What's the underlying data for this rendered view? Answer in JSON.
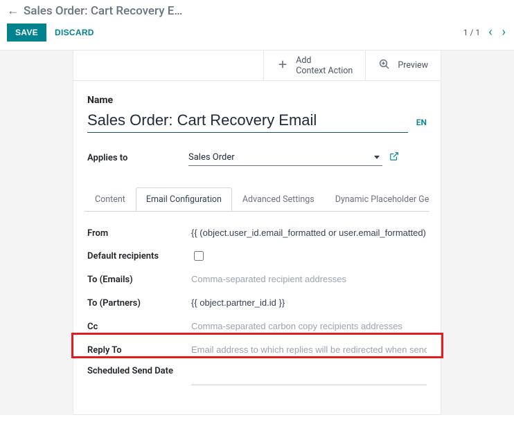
{
  "breadcrumb": {
    "title": "Sales Order: Cart Recovery E…"
  },
  "actions": {
    "save": "SAVE",
    "discard": "DISCARD"
  },
  "pager": {
    "count": "1 / 1"
  },
  "buttonBox": {
    "addContext": {
      "line1": "Add",
      "line2": "Context Action"
    },
    "preview": "Preview"
  },
  "form": {
    "nameLabel": "Name",
    "nameValue": "Sales Order: Cart Recovery Email",
    "lang": "EN",
    "appliesLabel": "Applies to",
    "appliesValue": "Sales Order"
  },
  "tabs": {
    "content": "Content",
    "emailConfig": "Email Configuration",
    "advanced": "Advanced Settings",
    "dynamic": "Dynamic Placeholder Generator"
  },
  "emailConfig": {
    "fromLabel": "From",
    "fromValue": "{{ (object.user_id.email_formatted or user.email_formatted) }}",
    "defaultRecipientsLabel": "Default recipients",
    "toEmailsLabel": "To (Emails)",
    "toEmailsPlaceholder": "Comma-separated recipient addresses",
    "toPartnersLabel": "To (Partners)",
    "toPartnersValue": "{{ object.partner_id.id }}",
    "ccLabel": "Cc",
    "ccPlaceholder": "Comma-separated carbon copy recipients addresses",
    "replyToLabel": "Reply To",
    "replyToPlaceholder": "Email address to which replies will be redirected when sending emails",
    "scheduledLabel": "Scheduled Send Date"
  }
}
